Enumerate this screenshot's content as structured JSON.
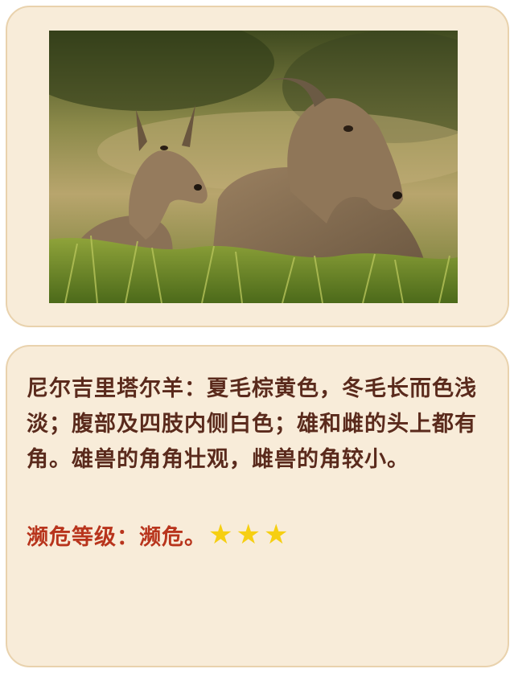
{
  "photo": {
    "subject": "adult nilgiri tahr lying in grass with a young kid beside it"
  },
  "description": {
    "text": "尼尔吉里塔尔羊：夏毛棕黄色，冬毛长而色浅淡；腹部及四肢内侧白色；雄和雌的头上都有角。雄兽的角角壮观，雌兽的角较小。"
  },
  "conservation": {
    "label": "濒危等级：",
    "value": "濒危。",
    "stars": [
      "★",
      "★",
      "★"
    ],
    "star_color": "#f6cf12"
  },
  "colors": {
    "card_background": "#f8ecd9",
    "card_border": "#e9d2ad",
    "description_text": "#5a2a1c",
    "status_text": "#b8341c"
  }
}
